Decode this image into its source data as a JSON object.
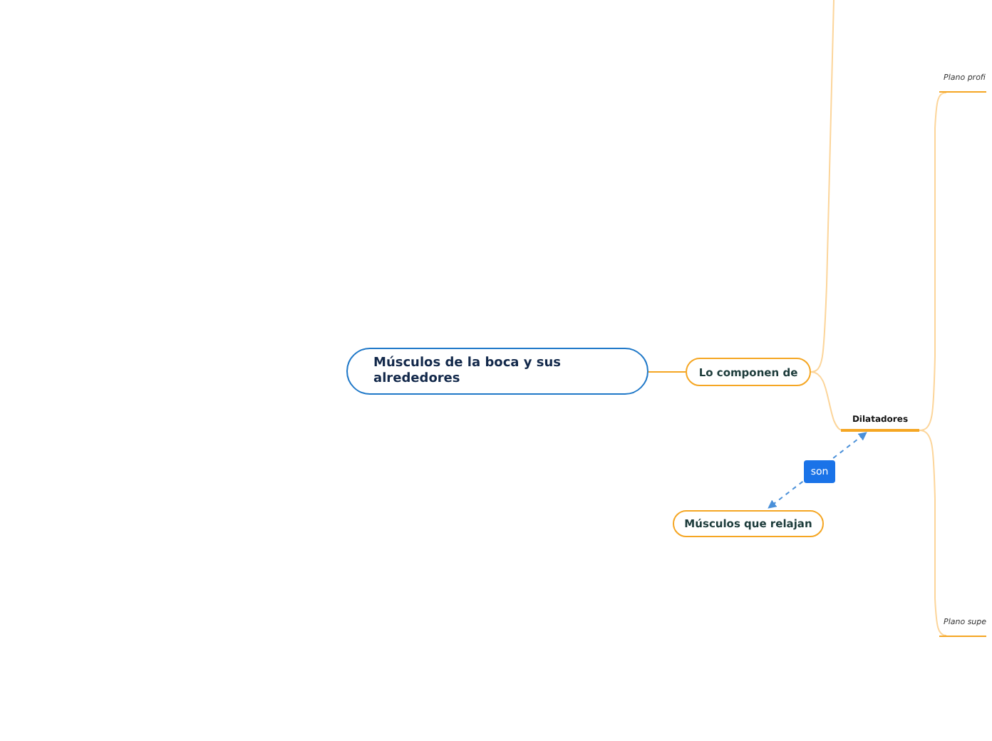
{
  "central_topic": {
    "text": "Músculos de la boca y sus alrededores"
  },
  "topics": [
    {
      "kind": "main",
      "text": "Lo componen de"
    },
    {
      "kind": "sub",
      "text": "Dilatadores"
    },
    {
      "kind": "leaf",
      "text": "Plano profi"
    },
    {
      "kind": "leaf",
      "text": "Plano supe"
    },
    {
      "kind": "floating",
      "text": "Músculos que relajan"
    }
  ],
  "relationship": {
    "label": "son"
  }
}
